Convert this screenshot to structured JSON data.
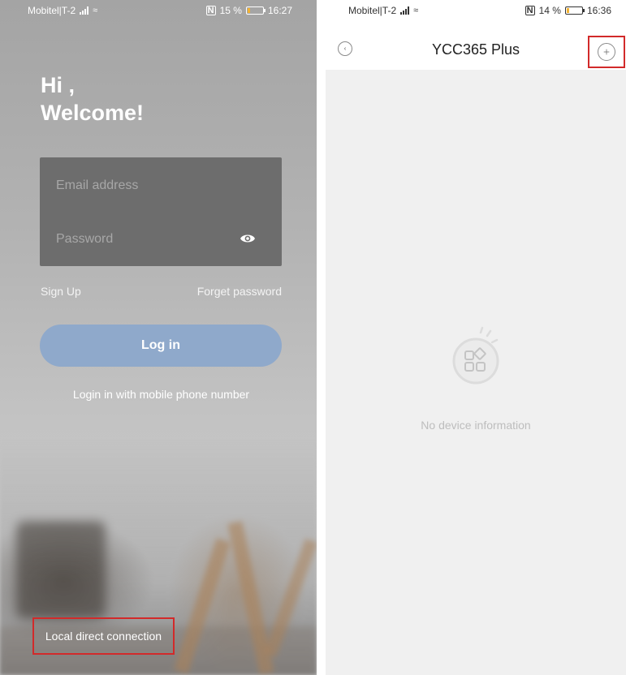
{
  "login_screen": {
    "status_bar": {
      "carrier": "Mobitel|T-2",
      "battery": "15 %",
      "battery_level": 0.15,
      "time": "16:27"
    },
    "greeting_line1": "Hi ,",
    "greeting_line2": "Welcome!",
    "email_field": {
      "placeholder": "Email address",
      "value": ""
    },
    "password_field": {
      "placeholder": "Password",
      "value": ""
    },
    "sign_up": "Sign Up",
    "forget_password": "Forget password",
    "login_button": "Log in",
    "mobile_login": "Login in with mobile phone number",
    "local_connection": "Local direct connection",
    "icons": [
      "eye-icon"
    ],
    "colors": {
      "login_button": "#8fa9cb",
      "highlight_box": "#d22a2a",
      "form_box": "#6d6d6d"
    }
  },
  "device_screen": {
    "status_bar": {
      "carrier": "Mobitel|T-2",
      "battery": "14 %",
      "battery_level": 0.14,
      "time": "16:36"
    },
    "title": "YCC365 Plus",
    "empty_message": "No device information",
    "icons": [
      "back-icon",
      "add-icon",
      "no-device-icon"
    ],
    "colors": {
      "background": "#f0f0f0",
      "highlight_box": "#d22a2a"
    }
  }
}
